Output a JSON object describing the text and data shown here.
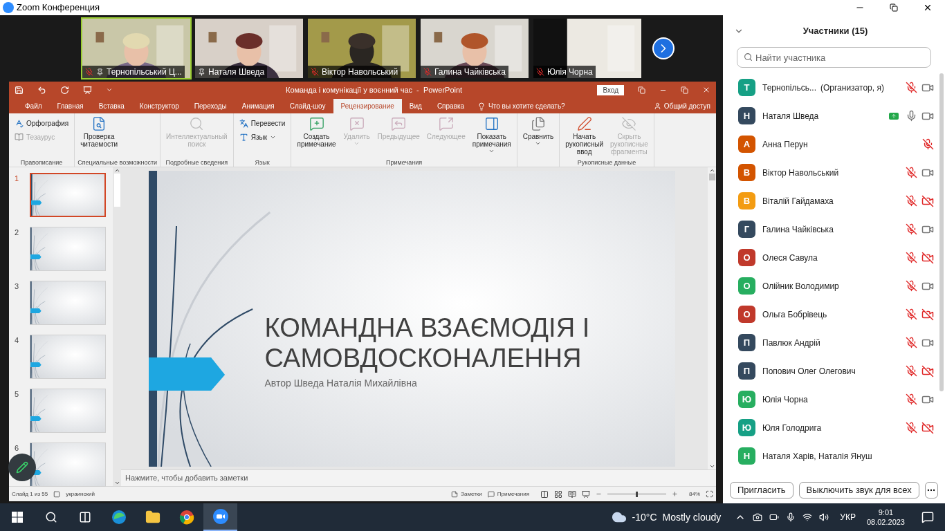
{
  "zoom": {
    "title": "Zoom Конференция"
  },
  "videos": [
    {
      "name": "Тернопільський Ц...",
      "muted": true,
      "pinned": true,
      "active": true
    },
    {
      "name": "Наталя Шведа",
      "muted": false,
      "pinned": true,
      "active": false
    },
    {
      "name": "Віктор Навольський",
      "muted": true,
      "pinned": false,
      "active": false
    },
    {
      "name": "Галина Чайківська",
      "muted": true,
      "pinned": false,
      "active": false
    },
    {
      "name": "Юлія Чорна",
      "muted": true,
      "pinned": false,
      "active": false
    }
  ],
  "powerpoint": {
    "title": "Команда і комунікації у воєнний час  -  PowerPoint",
    "signin": "Вход",
    "tabs": [
      {
        "label": "Файл",
        "selected": false
      },
      {
        "label": "Главная",
        "selected": false
      },
      {
        "label": "Вставка",
        "selected": false
      },
      {
        "label": "Конструктор",
        "selected": false
      },
      {
        "label": "Переходы",
        "selected": false
      },
      {
        "label": "Анимация",
        "selected": false
      },
      {
        "label": "Слайд-шоу",
        "selected": false
      },
      {
        "label": "Рецензирование",
        "selected": true
      },
      {
        "label": "Вид",
        "selected": false
      },
      {
        "label": "Справка",
        "selected": false
      }
    ],
    "tell_me": "Что вы хотите сделать?",
    "share": "Общий доступ",
    "ribbon": [
      {
        "label": "Правописание",
        "items": [
          {
            "kind": "small",
            "label": "Орфография",
            "disabled": false,
            "dropdown": false
          },
          {
            "kind": "small",
            "label": "Тезаурус",
            "disabled": true,
            "dropdown": false
          }
        ]
      },
      {
        "label": "Специальные возможности",
        "items": [
          {
            "kind": "large",
            "label": "Проверка читаемости",
            "disabled": false,
            "dropdown": false
          }
        ]
      },
      {
        "label": "Подробные сведения",
        "items": [
          {
            "kind": "large",
            "label": "Интеллектуальный поиск",
            "disabled": true,
            "dropdown": false
          }
        ]
      },
      {
        "label": "Язык",
        "items": [
          {
            "kind": "small",
            "label": "Перевести",
            "disabled": false,
            "dropdown": false
          },
          {
            "kind": "small",
            "label": "Язык",
            "disabled": false,
            "dropdown": true
          }
        ]
      },
      {
        "label": "Примечания",
        "items": [
          {
            "kind": "large",
            "label": "Создать примечание",
            "disabled": false,
            "dropdown": false
          },
          {
            "kind": "large",
            "label": "Удалить",
            "disabled": true,
            "dropdown": true
          },
          {
            "kind": "large",
            "label": "Предыдущее",
            "disabled": true,
            "dropdown": false
          },
          {
            "kind": "large",
            "label": "Следующее",
            "disabled": true,
            "dropdown": false
          },
          {
            "kind": "large",
            "label": "Показать примечания",
            "disabled": false,
            "dropdown": true
          }
        ]
      },
      {
        "items": [
          {
            "kind": "large",
            "label": "Сравнить",
            "disabled": false,
            "dropdown": true
          }
        ]
      },
      {
        "label": "Рукописные данные",
        "items": [
          {
            "kind": "large",
            "label": "Начать рукописный ввод",
            "disabled": false,
            "dropdown": false
          },
          {
            "kind": "large",
            "label": "Скрыть рукописные фрагменты",
            "disabled": true,
            "dropdown": false
          }
        ]
      }
    ],
    "slides": [
      {
        "number": "1",
        "selected": true
      },
      {
        "number": "2",
        "selected": false
      },
      {
        "number": "3",
        "selected": false
      },
      {
        "number": "4",
        "selected": false
      },
      {
        "number": "5",
        "selected": false
      },
      {
        "number": "6",
        "selected": false
      }
    ],
    "slide": {
      "title": "КОМАНДНА ВЗАЄМОДІЯ І САМОВДОСКОНАЛЕННЯ",
      "subtitle": "Автор Шведа Наталія Михайлівна"
    },
    "notes_placeholder": "Нажмите, чтобы добавить заметки",
    "status": {
      "slide": "Слайд 1 из 55",
      "language": "украинский",
      "notes": "Заметки",
      "comments": "Примечания",
      "zoom": "84%",
      "level": 0.5
    }
  },
  "participants": {
    "title": "Участники (15)",
    "search": {
      "placeholder": "Найти участника"
    },
    "list": [
      {
        "initial": "Т",
        "color": "#16a085",
        "name": "Тернопільсь...",
        "role": "(Организатор, я)",
        "sharing": false,
        "muted": true,
        "video_off": false
      },
      {
        "initial": "Н",
        "color": "#34495e",
        "name": "Наталя Шведа",
        "sharing": true,
        "muted": false,
        "video_off": false
      },
      {
        "initial": "А",
        "color": "#d35400",
        "name": "Анна Перун",
        "sharing": false,
        "muted": true
      },
      {
        "initial": "В",
        "color": "#d35400",
        "name": "Віктор Навольський",
        "sharing": false,
        "muted": true,
        "video_off": false
      },
      {
        "initial": "В",
        "color": "#f39c12",
        "name": "Віталій Гайдамаха",
        "sharing": false,
        "muted": true,
        "video_off": true
      },
      {
        "initial": "Г",
        "color": "#34495e",
        "name": "Галина Чайківська",
        "sharing": false,
        "muted": true,
        "video_off": false
      },
      {
        "initial": "О",
        "color": "#c0392b",
        "name": "Олеся Савула",
        "sharing": false,
        "muted": true,
        "video_off": true
      },
      {
        "initial": "О",
        "color": "#27ae60",
        "name": "Олійник Володимир",
        "sharing": false,
        "muted": true,
        "video_off": false
      },
      {
        "initial": "О",
        "color": "#c0392b",
        "name": "Ольга Бобрівець",
        "sharing": false,
        "muted": true,
        "video_off": true
      },
      {
        "initial": "П",
        "color": "#34495e",
        "name": "Павлюк Андрій",
        "sharing": false,
        "muted": true,
        "video_off": false
      },
      {
        "initial": "П",
        "color": "#34495e",
        "name": "Попович Олег Олегович",
        "sharing": false,
        "muted": true,
        "video_off": true
      },
      {
        "initial": "Ю",
        "color": "#27ae60",
        "name": "Юлія Чорна",
        "sharing": false,
        "muted": true,
        "video_off": false
      },
      {
        "initial": "Ю",
        "color": "#16a085",
        "name": "Юля Голодрига",
        "sharing": false,
        "muted": true,
        "video_off": true
      },
      {
        "initial": "Н",
        "color": "#27ae60",
        "name": "Наталя Харів, Наталія Януш",
        "sharing": false
      }
    ],
    "buttons": [
      "Пригласить",
      "Выключить звук для всех"
    ]
  },
  "taskbar": {
    "apps": [
      {
        "selected": false
      },
      {
        "selected": false
      },
      {
        "selected": false
      },
      {
        "selected": false
      },
      {
        "selected": false
      },
      {
        "selected": false
      },
      {
        "selected": true
      }
    ],
    "temperature": "-10°C",
    "weather": "Mostly cloudy",
    "language": "УКР",
    "time": "9:01",
    "date": "08.02.2023"
  }
}
